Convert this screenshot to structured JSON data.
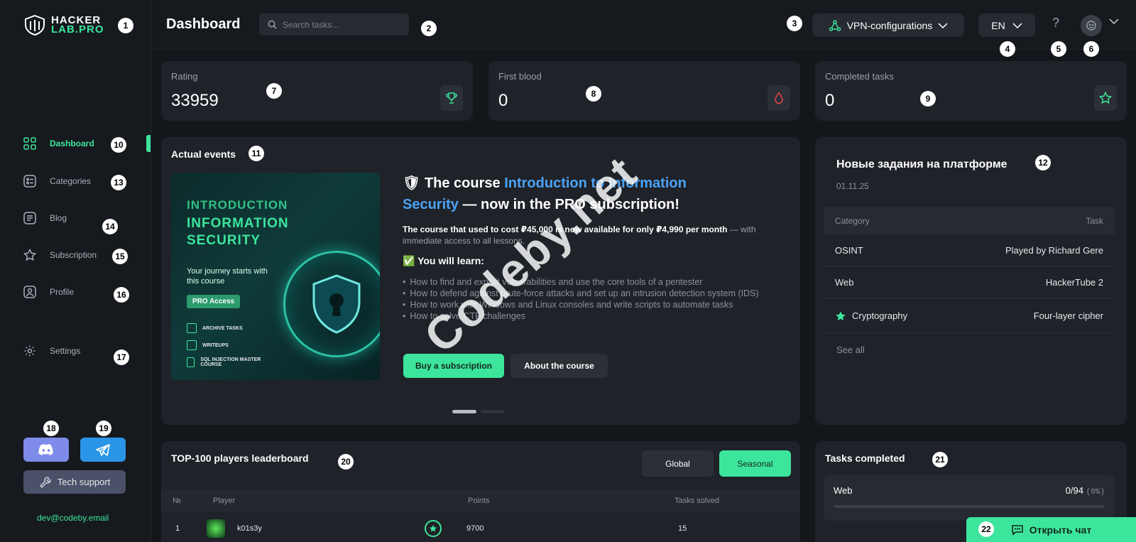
{
  "brand": {
    "line1": "HACKER",
    "line2": "LAB.PRO"
  },
  "sidebar": {
    "items": [
      {
        "label": "Dashboard",
        "icon": "grid-icon",
        "active": true
      },
      {
        "label": "Categories",
        "icon": "categories-icon"
      },
      {
        "label": "Blog",
        "icon": "blog-icon"
      },
      {
        "label": "Subscription",
        "icon": "star-icon"
      },
      {
        "label": "Profile",
        "icon": "user-icon"
      },
      {
        "label": "Settings",
        "icon": "gear-icon"
      }
    ],
    "tech_support": "Tech support",
    "email": "dev@codeby.email"
  },
  "header": {
    "title": "Dashboard",
    "search_placeholder": "Search tasks...",
    "vpn_label": "VPN-configurations",
    "lang": "EN",
    "help": "?"
  },
  "stats": {
    "rating": {
      "label": "Rating",
      "value": "33959"
    },
    "first_blood": {
      "label": "First blood",
      "value": "0"
    },
    "completed": {
      "label": "Completed tasks",
      "value": "0"
    }
  },
  "events": {
    "title": "Actual events",
    "image": {
      "line1": "INTRODUCTION",
      "line2": "INFORMATION SECURITY",
      "tagline": "Your journey starts with this course",
      "badge": "PRO Access",
      "items": [
        "ARCHIVE TASKS",
        "WRITEUPS",
        "SQL INJECTION MASTER COURSE"
      ]
    },
    "headline_pre": "🛡 The course ",
    "headline_link": "Introduction to Information Security",
    "headline_post": " — now in the PRO subscription!",
    "sub_bold": "The course that used to cost ₽45,000 is now available for only ₽4,990 per month",
    "sub_rest": " — with immediate access to all lessons.",
    "learn_title": "✅ You will learn:",
    "learn_items": [
      "How to find and exploit vulnerabilities and use the core tools of a pentester",
      "How to defend against brute-force attacks and set up an intrusion detection system (IDS)",
      "How to work with Windows and Linux consoles and write scripts to automate tasks",
      "How to solve CTF challenges"
    ],
    "buy_label": "Buy a subscription",
    "about_label": "About the course"
  },
  "new_tasks": {
    "title": "Новые задания на платформе",
    "date": "01.11.25",
    "col_category": "Category",
    "col_task": "Task",
    "rows": [
      {
        "category": "OSINT",
        "task": "Played by Richard Gere"
      },
      {
        "category": "Web",
        "task": "HackerTube 2"
      },
      {
        "category": "Cryptography",
        "task": "Four-layer cipher"
      }
    ],
    "see_all": "See all"
  },
  "leaderboard": {
    "title": "TOP-100 players leaderboard",
    "tab_global": "Global",
    "tab_seasonal": "Seasonal",
    "col_no": "№",
    "col_player": "Player",
    "col_points": "Points",
    "col_tasks": "Tasks solved",
    "rows": [
      {
        "no": "1",
        "player": "k01s3y",
        "points": "9700",
        "tasks": "15"
      }
    ]
  },
  "tasks_completed": {
    "title": "Tasks completed",
    "category": "Web",
    "count": "0/94",
    "percent": "(0%)",
    "progress": 0
  },
  "chat": {
    "label": "Открыть чат"
  },
  "watermark": "Codeby.net",
  "badges": [
    "1",
    "2",
    "3",
    "4",
    "5",
    "6",
    "7",
    "8",
    "9",
    "10",
    "11",
    "12",
    "13",
    "14",
    "15",
    "16",
    "17",
    "18",
    "19",
    "20",
    "21",
    "22"
  ],
  "colors": {
    "accent": "#3de59c",
    "link": "#4ba3f5",
    "discord": "#7e8be8",
    "telegram": "#2a95e6"
  }
}
